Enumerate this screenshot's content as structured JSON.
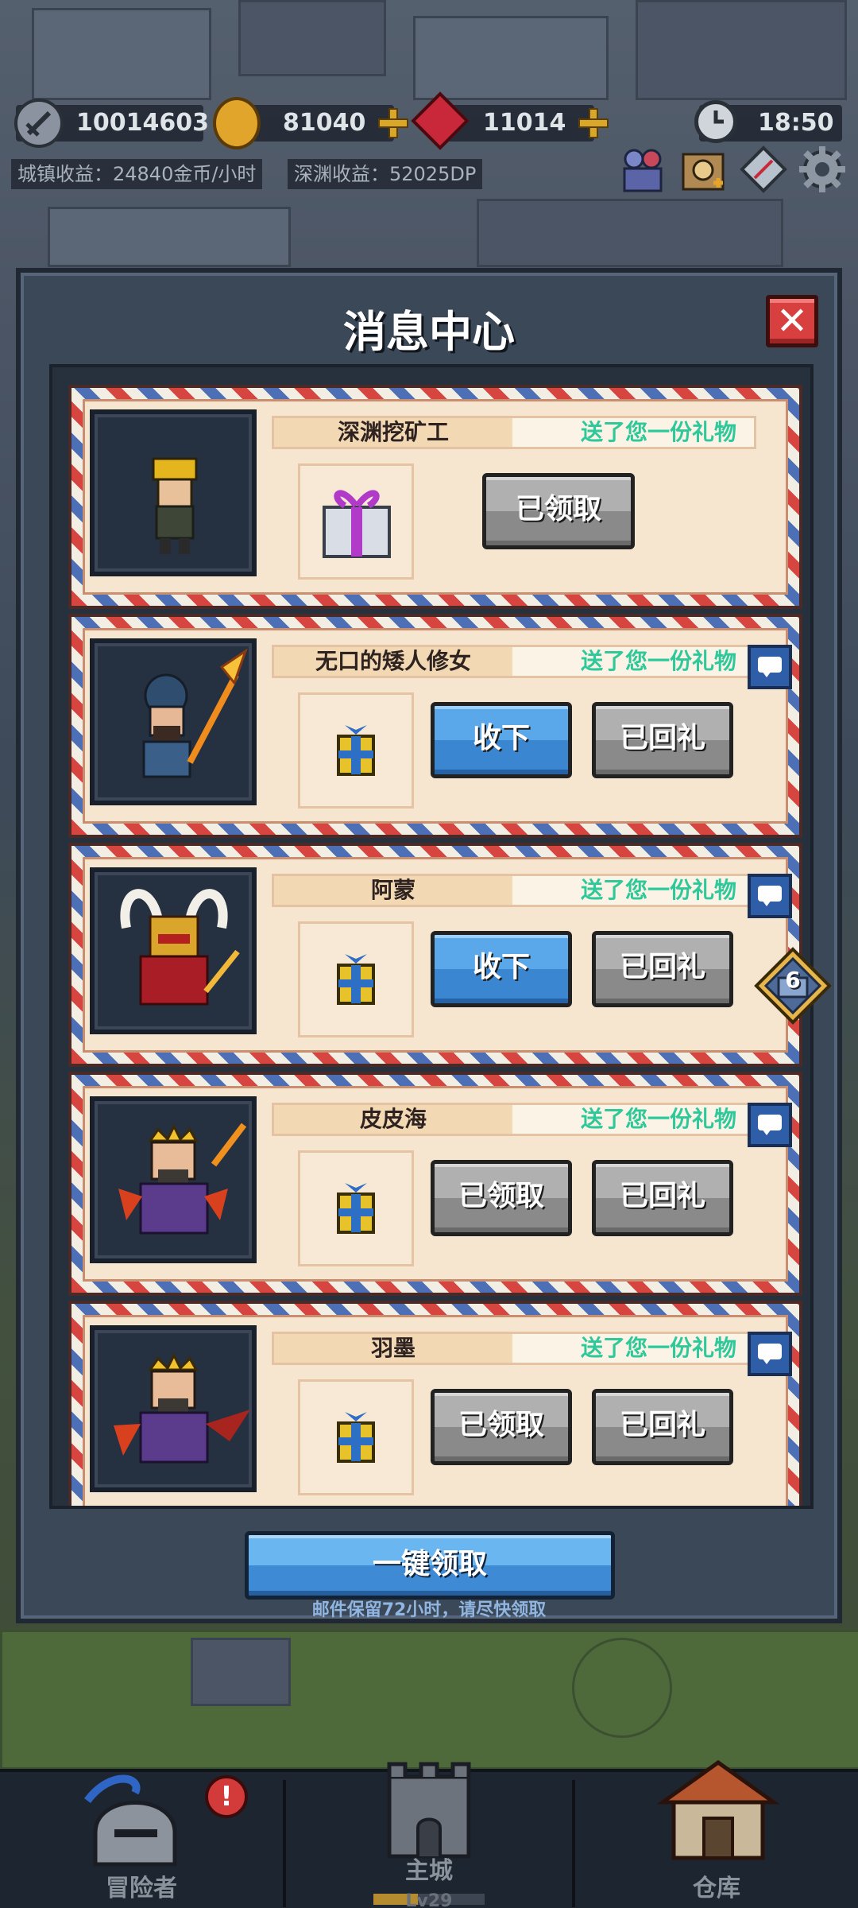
{
  "hud": {
    "power": "10014603",
    "gold": "81040",
    "gems": "11014",
    "clock": "18:50",
    "town_income": "城镇收益：24840金币/小时",
    "abyss_income": "深渊收益：52025DP"
  },
  "modal": {
    "title": "消息中心",
    "claim_all_label": "一键领取",
    "retention_note": "邮件保留72小时，请尽快领取",
    "side_badge_count": "6"
  },
  "messages": [
    {
      "sender": "深渊挖矿工",
      "note": "送了您一份礼物",
      "gift": "large-purple-gift",
      "primary": "已领取",
      "primary_style": "gray",
      "secondary": null,
      "has_chat": false
    },
    {
      "sender": "无口的矮人修女",
      "note": "送了您一份礼物",
      "gift": "small-gold-gift",
      "primary": "收下",
      "primary_style": "blue",
      "secondary": "已回礼",
      "has_chat": true
    },
    {
      "sender": "阿蒙",
      "note": "送了您一份礼物",
      "gift": "small-gold-gift",
      "primary": "收下",
      "primary_style": "blue",
      "secondary": "已回礼",
      "has_chat": true
    },
    {
      "sender": "皮皮海",
      "note": "送了您一份礼物",
      "gift": "small-gold-gift",
      "primary": "已领取",
      "primary_style": "gray",
      "secondary": "已回礼",
      "has_chat": true
    },
    {
      "sender": "羽墨",
      "note": "送了您一份礼物",
      "gift": "small-gold-gift",
      "primary": "已领取",
      "primary_style": "gray",
      "secondary": "已回礼",
      "has_chat": true
    }
  ],
  "nav": {
    "adventurer": "冒险者",
    "main_city": "主城",
    "main_city_level": "Lv29",
    "warehouse": "仓库"
  },
  "colors": {
    "gift_note": "#2fc89a",
    "accent_blue": "#3b86d1",
    "close_red": "#d83f3f"
  }
}
